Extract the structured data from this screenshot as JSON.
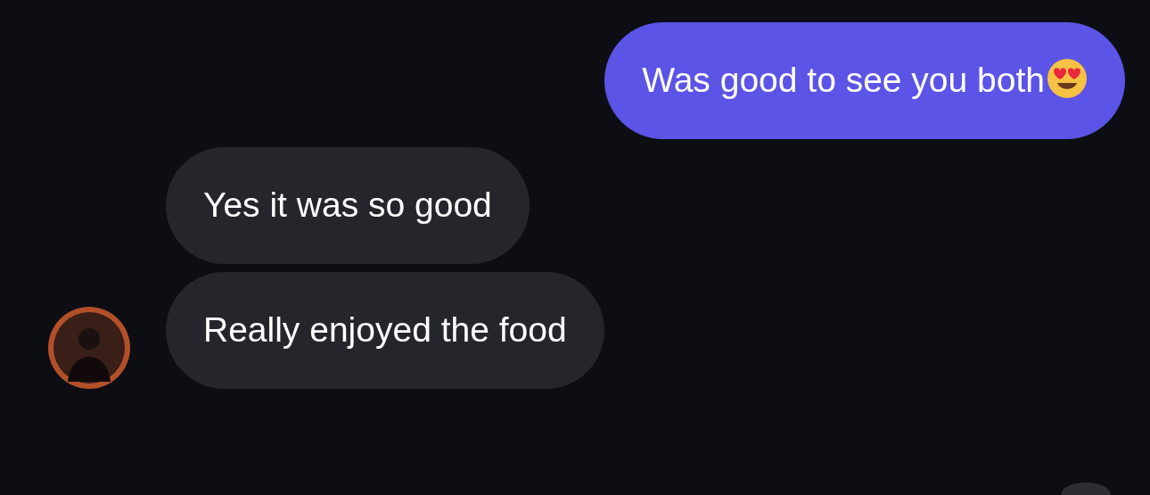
{
  "messages": [
    {
      "kind": "sent",
      "text": "Was good to see you both",
      "emoji": true,
      "show_avatar": false
    },
    {
      "kind": "received",
      "text": "Yes it was so good",
      "emoji": false,
      "show_avatar": false
    },
    {
      "kind": "received",
      "text": "Really enjoyed the food",
      "emoji": false,
      "show_avatar": true
    }
  ]
}
